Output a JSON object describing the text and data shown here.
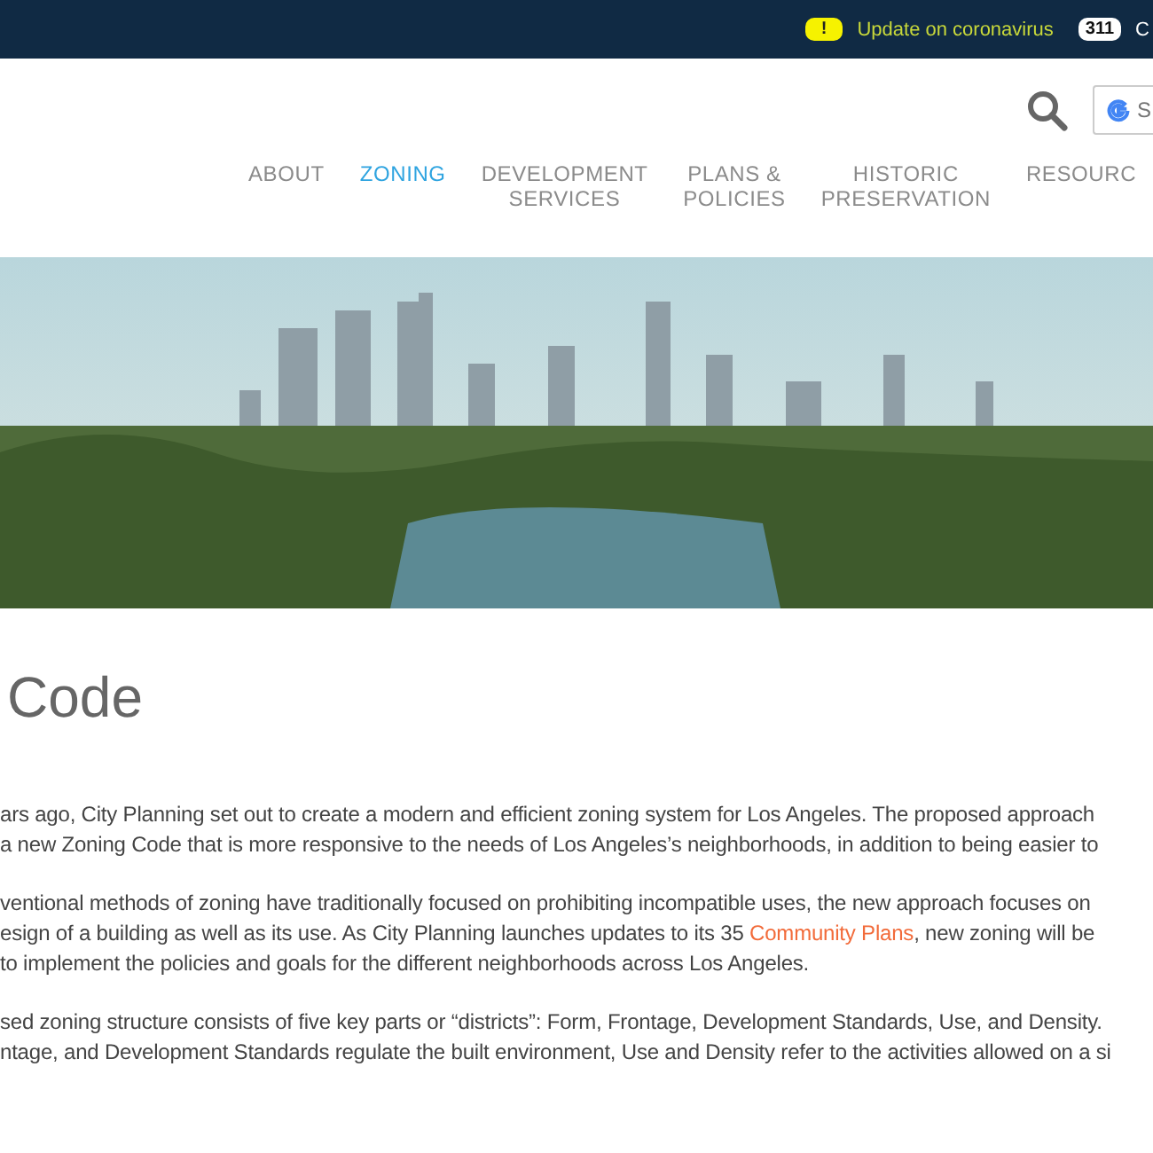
{
  "top_bar": {
    "alert_icon": "!",
    "alert": "Update on coronavirus",
    "hotline": "311",
    "cut_text": "C"
  },
  "header": {
    "search_field": {
      "placeholder": "S"
    }
  },
  "nav": [
    {
      "label": "ABOUT",
      "selected": false
    },
    {
      "label": "ZONING",
      "selected": true
    },
    {
      "label": "DEVELOPMENT SERVICES",
      "selected": false
    },
    {
      "label": "PLANS & POLICIES",
      "selected": false
    },
    {
      "label": "HISTORIC PRESERVATION",
      "selected": false
    },
    {
      "label": "RESOURC",
      "selected": false
    }
  ],
  "page": {
    "title": "Code",
    "paragraphs": [
      [
        {
          "parts": [
            {
              "kind": "text",
              "text": "ars ago, City Planning set out to create a modern and efficient zoning system for Los Angeles. The proposed approach"
            }
          ]
        },
        {
          "parts": [
            {
              "kind": "text",
              "text": "a new Zoning Code that is more responsive to the needs of Los Angeles’s neighborhoods, in addition to being easier to"
            }
          ]
        }
      ],
      [
        {
          "parts": [
            {
              "kind": "text",
              "text": "ventional methods of zoning have traditionally focused on prohibiting incompatible uses, the new approach focuses on"
            }
          ]
        },
        {
          "parts": [
            {
              "kind": "text",
              "text": "esign of a building as well as its use. As City Planning launches updates to its 35 "
            },
            {
              "kind": "link",
              "text": "Community Plans"
            },
            {
              "kind": "text",
              "text": ", new zoning will be"
            }
          ]
        },
        {
          "parts": [
            {
              "kind": "text",
              "text": "to implement the policies and goals for the different neighborhoods across Los Angeles."
            }
          ]
        }
      ],
      [
        {
          "parts": [
            {
              "kind": "text",
              "text": "sed zoning structure consists of five key parts or “districts”: Form, Frontage, Development Standards, Use, and Density."
            }
          ]
        },
        {
          "parts": [
            {
              "kind": "text",
              "text": "ntage, and Development Standards regulate the built environment, Use and Density refer to the activities allowed on a si"
            }
          ]
        }
      ]
    ]
  }
}
